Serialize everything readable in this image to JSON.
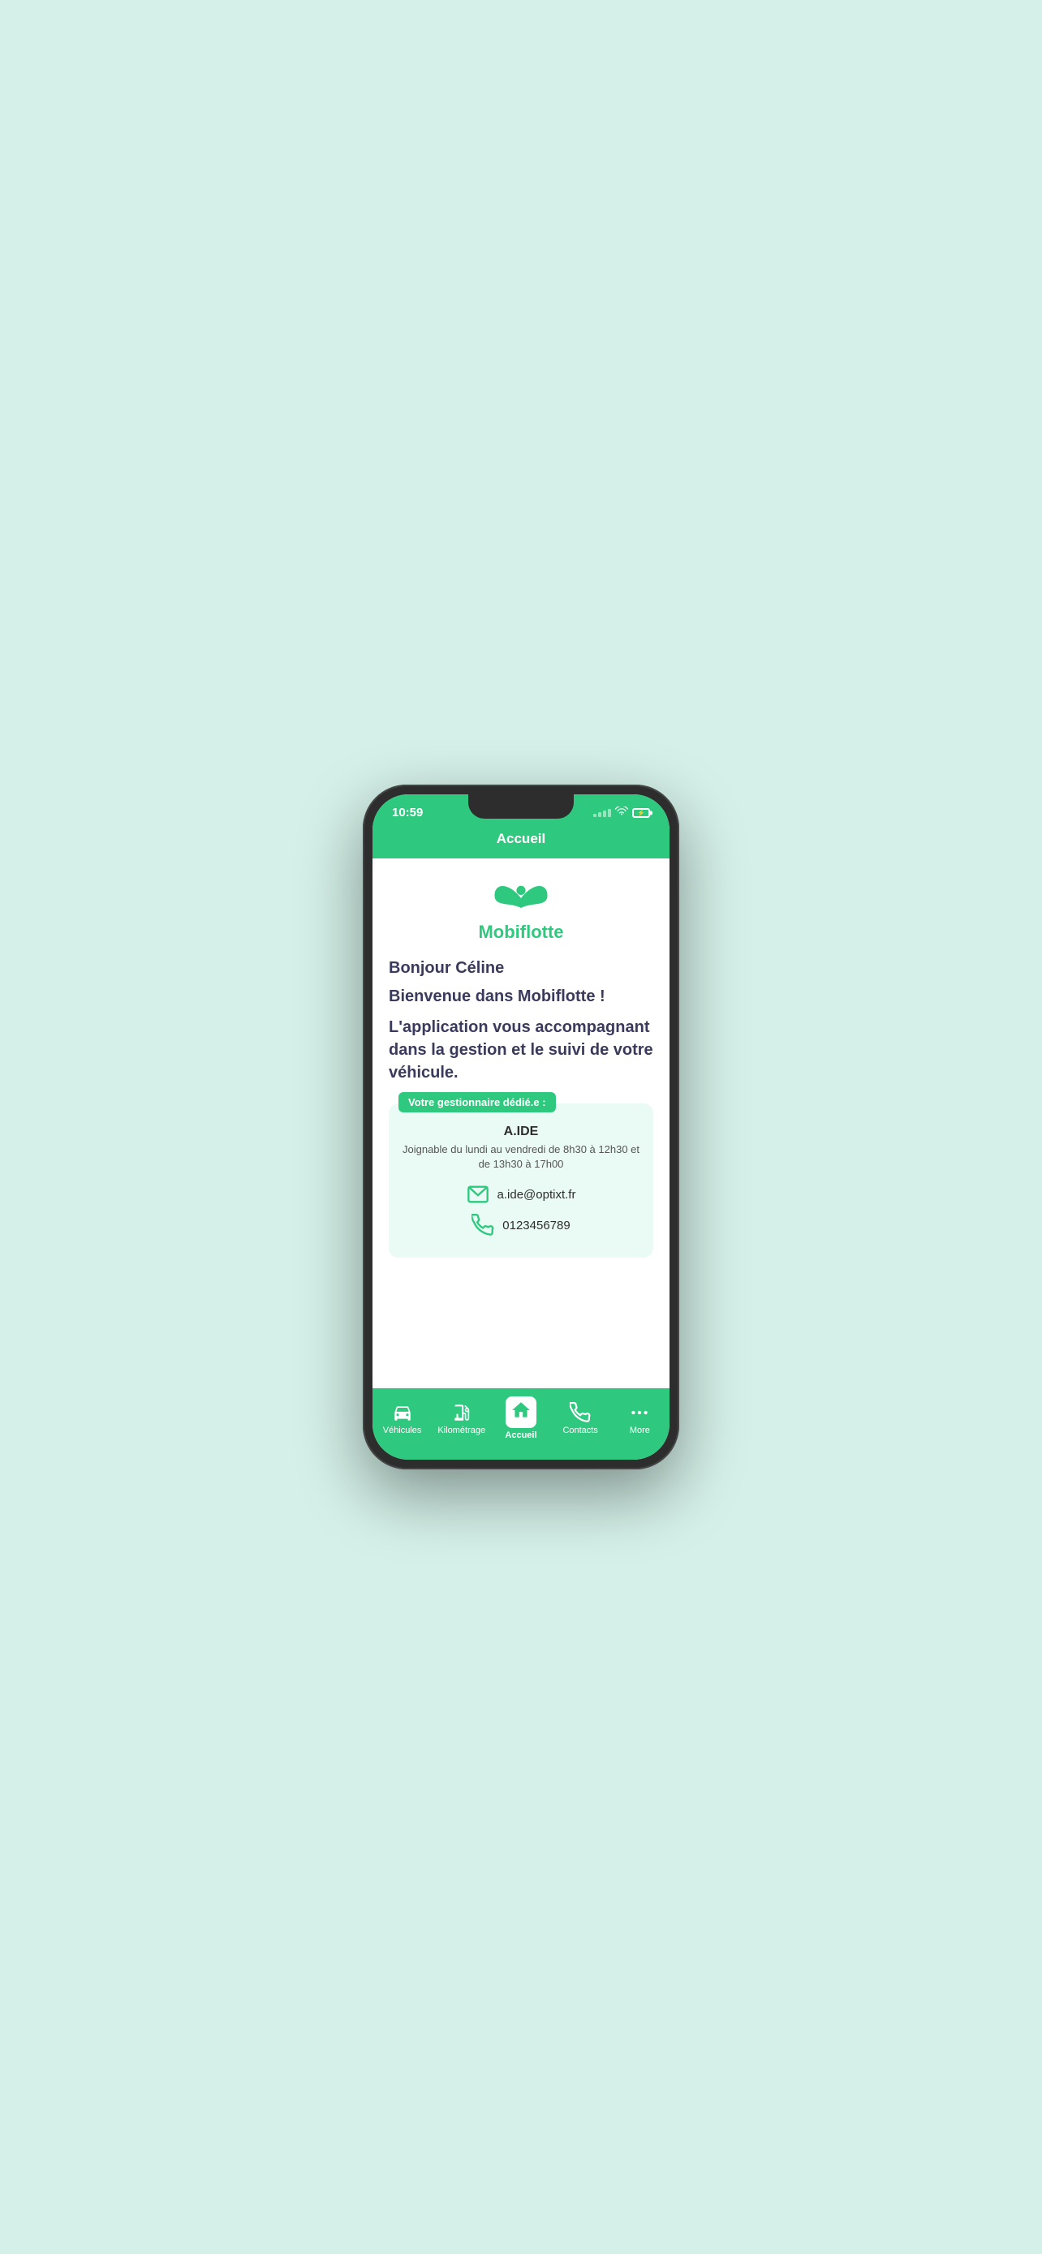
{
  "status": {
    "time": "10:59"
  },
  "header": {
    "title": "Accueil"
  },
  "logo": {
    "text": "Mobiflotte"
  },
  "content": {
    "greeting": "Bonjour Céline",
    "welcome": "Bienvenue dans Mobiflotte !",
    "description": "L'application vous accompagnant dans la gestion et le suivi de votre véhicule.",
    "manager_label": "Votre gestionnaire dédié.e :",
    "manager_name": "A.IDE",
    "manager_hours": "Joignable du lundi au vendredi de 8h30 à 12h30 et de 13h30 à 17h00",
    "manager_email": "a.ide@optixt.fr",
    "manager_phone": "0123456789"
  },
  "tabs": [
    {
      "id": "vehicules",
      "label": "Véhicules",
      "active": false
    },
    {
      "id": "kilometrage",
      "label": "Kilométrage",
      "active": false
    },
    {
      "id": "accueil",
      "label": "Accueil",
      "active": true
    },
    {
      "id": "contacts",
      "label": "Contacts",
      "active": false
    },
    {
      "id": "more",
      "label": "More",
      "active": false
    }
  ],
  "colors": {
    "primary": "#2ec97e",
    "text_dark": "#3a3a5c"
  }
}
